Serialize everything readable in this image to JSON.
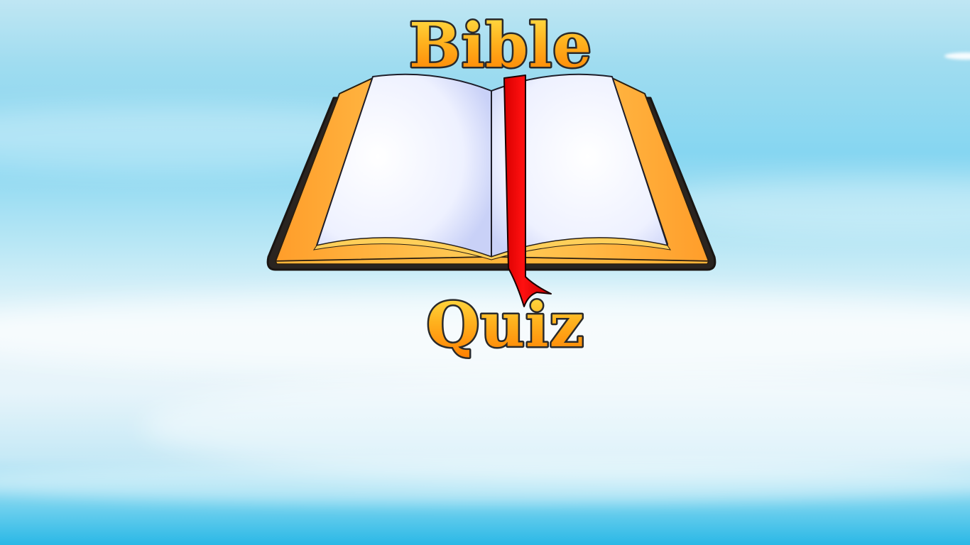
{
  "title": {
    "line1": "Bible",
    "line2": "Quiz"
  },
  "colors": {
    "title_fill_top": "#ffd23a",
    "title_fill_bottom": "#ff8a00",
    "title_outline": "#2a2a2a",
    "book_cover": "#ffb43a",
    "book_edge": "#2a2420",
    "page": "#f4f6ff",
    "bookmark": "#ff0000",
    "sky_top": "#bfe6f3",
    "sky_bottom": "#2ab8e6"
  },
  "icons": {
    "logo": "open-bible-book-icon",
    "bookmark": "red-ribbon-bookmark"
  }
}
